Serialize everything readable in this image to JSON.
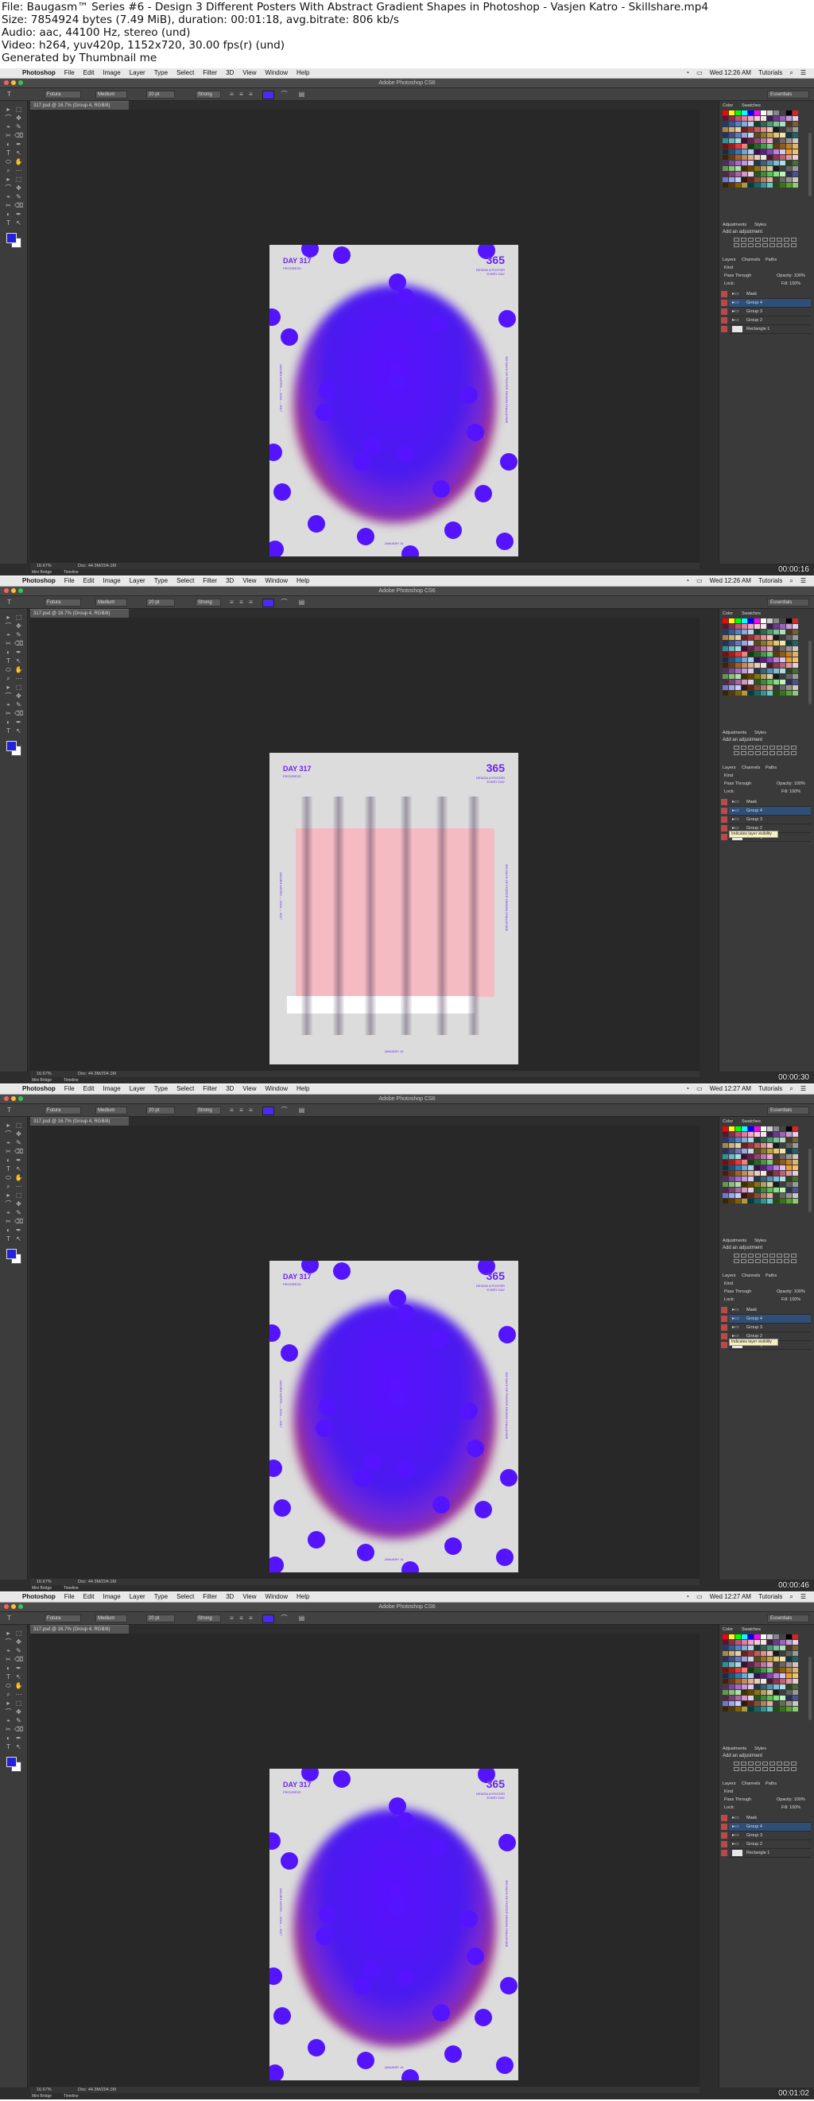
{
  "header": {
    "line1": "File: Baugasm™ Series #6 - Design 3 Different Posters With Abstract Gradient Shapes in Photoshop - Vasjen Katro - Skillshare.mp4",
    "line2": "Size: 7854924 bytes (7.49 MiB), duration: 00:01:18, avg.bitrate: 806 kb/s",
    "line3": "Audio: aac, 44100 Hz, stereo (und)",
    "line4": "Video: h264, yuv420p, 1152x720, 30.00 fps(r) (und)",
    "line5": "Generated by Thumbnail me"
  },
  "app": {
    "window_title": "Adobe Photoshop CS6",
    "doc_tab": "317.psd @ 16.7% (Group 4, RGB/8)",
    "menus": [
      "Photoshop",
      "File",
      "Edit",
      "Image",
      "Layer",
      "Type",
      "Select",
      "Filter",
      "3D",
      "View",
      "Window",
      "Help"
    ],
    "right_menu": "Tutorials",
    "workspace": "Essentials",
    "font_family": "Futura",
    "font_style": "Medium",
    "font_size": "20 pt",
    "aa_mode": "Strong",
    "zoom": "16.67%",
    "doc_info": "Doc: 44.3M/204.1M",
    "bottom_tabs": [
      "Mini Bridge",
      "Timeline"
    ]
  },
  "panels": {
    "tabs_top": [
      "Color",
      "Swatches"
    ],
    "tabs_adj": [
      "Adjustments",
      "Styles"
    ],
    "adj_title": "Add an adjustment",
    "tabs_layers": [
      "Layers",
      "Channels",
      "Paths"
    ],
    "kind": "Kind",
    "blend": "Pass Through",
    "opacity": "Opacity: 100%",
    "lock": "Lock:",
    "fill": "Fill: 100%",
    "layers": [
      "Mask",
      "Group 4",
      "Group 3",
      "Group 2",
      "Rectangle 1"
    ],
    "tooltip": "Indicates layer visibility"
  },
  "poster": {
    "day": "DAY 317",
    "sub": "PROGRESS",
    "num": "365",
    "small1": "DESIGN A POSTER",
    "small2": "EVERY DAY",
    "side_left": "VASJEN KATRO — 2016 — 2017",
    "side_right": "365 DAYS OF POSTER DESIGN CHALLENGE",
    "foot": "JANUARY 14"
  },
  "frames": [
    {
      "time": "Wed 12:26 AM",
      "timestamp": "00:00:16",
      "variant": "gradient",
      "tooltip": false,
      "selected_layer": 1
    },
    {
      "time": "Wed 12:26 AM",
      "timestamp": "00:00:30",
      "variant": "stripes",
      "tooltip": true,
      "selected_layer": 1
    },
    {
      "time": "Wed 12:27 AM",
      "timestamp": "00:00:46",
      "variant": "gradient",
      "tooltip": true,
      "selected_layer": 1
    },
    {
      "time": "Wed 12:27 AM",
      "timestamp": "00:01:02",
      "variant": "gradient",
      "tooltip": false,
      "selected_layer": 1
    }
  ],
  "colors": {
    "accent": "#5514ff",
    "gradient_red": "#d2341f",
    "poster_bg": "#dcdcdc",
    "pink": "#f4bcc2"
  }
}
